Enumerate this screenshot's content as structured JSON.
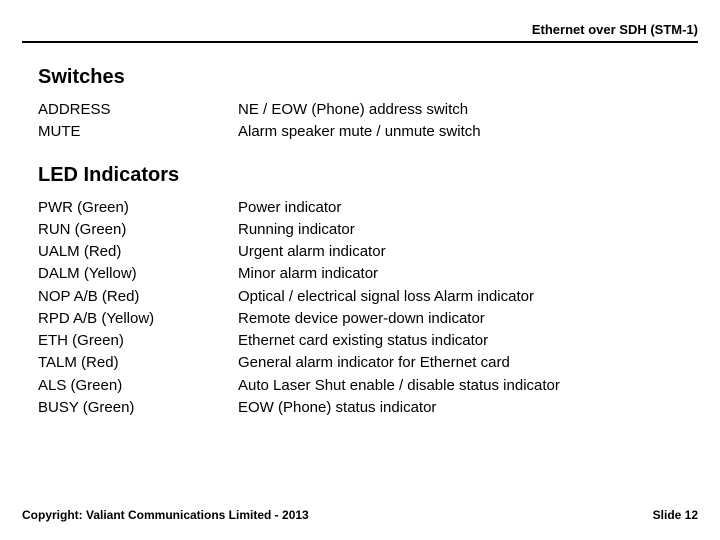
{
  "header": {
    "title": "Ethernet over SDH (STM-1)"
  },
  "sections": {
    "switches": {
      "heading": "Switches",
      "rows": [
        {
          "label": "ADDRESS",
          "desc": "NE / EOW (Phone) address switch"
        },
        {
          "label": "MUTE",
          "desc": "Alarm speaker mute / unmute switch"
        }
      ]
    },
    "leds": {
      "heading": "LED Indicators",
      "rows": [
        {
          "label": "PWR (Green)",
          "desc": "Power indicator"
        },
        {
          "label": "RUN (Green)",
          "desc": "Running indicator"
        },
        {
          "label": "UALM (Red)",
          "desc": "Urgent alarm indicator"
        },
        {
          "label": "DALM (Yellow)",
          "desc": "Minor alarm indicator"
        },
        {
          "label": "NOP A/B (Red)",
          "desc": "Optical / electrical signal loss Alarm indicator"
        },
        {
          "label": "RPD A/B (Yellow)",
          "desc": "Remote device power-down indicator"
        },
        {
          "label": "ETH (Green)",
          "desc": "Ethernet card existing status indicator"
        },
        {
          "label": "TALM (Red)",
          "desc": "General alarm indicator for Ethernet card"
        },
        {
          "label": "ALS (Green)",
          "desc": "Auto Laser Shut enable / disable status indicator"
        },
        {
          "label": "BUSY (Green)",
          "desc": "EOW (Phone) status indicator"
        }
      ]
    }
  },
  "footer": {
    "copyright": "Copyright: Valiant Communications Limited - 2013",
    "slide": "Slide 12"
  }
}
